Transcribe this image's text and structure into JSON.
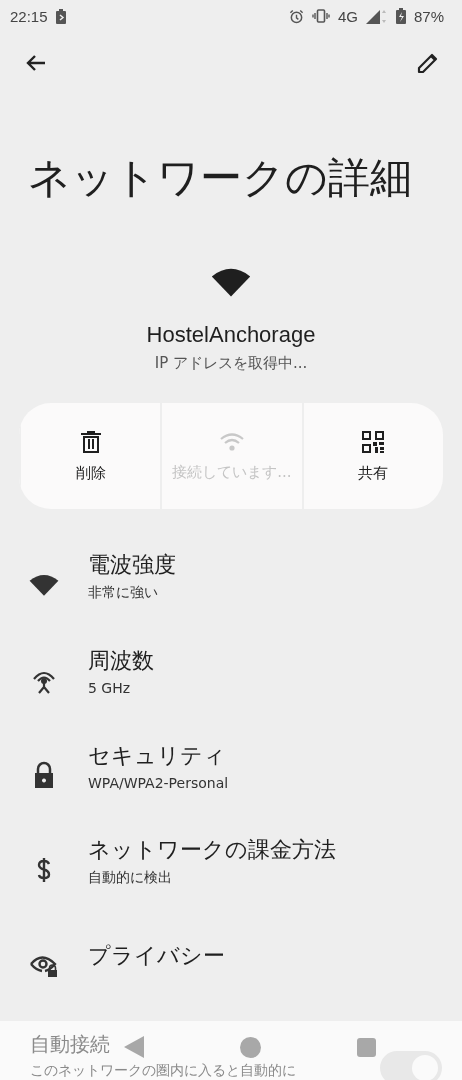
{
  "status_bar": {
    "time": "22:15",
    "network": "4G",
    "battery": "87%"
  },
  "title": "ネットワークの詳細",
  "network": {
    "name": "HostelAnchorage",
    "status": "IP アドレスを取得中..."
  },
  "actions": [
    {
      "kind": "delete",
      "label": "削除",
      "disabled": false
    },
    {
      "kind": "connect",
      "label": "接続しています...",
      "disabled": true
    },
    {
      "kind": "share",
      "label": "共有",
      "disabled": false
    }
  ],
  "details": [
    {
      "kind": "signal",
      "title": "電波強度",
      "subtitle": "非常に強い"
    },
    {
      "kind": "frequency",
      "title": "周波数",
      "subtitle": "5 GHz"
    },
    {
      "kind": "security",
      "title": "セキュリティ",
      "subtitle": "WPA/WPA2-Personal"
    },
    {
      "kind": "metered",
      "title": "ネットワークの課金方法",
      "subtitle": "自動的に検出"
    },
    {
      "kind": "privacy",
      "title": "プライバシー"
    }
  ],
  "auto_connect": {
    "title": "自動接続",
    "subtitle": "このネットワークの圏内に入ると自動的に",
    "on": true
  }
}
